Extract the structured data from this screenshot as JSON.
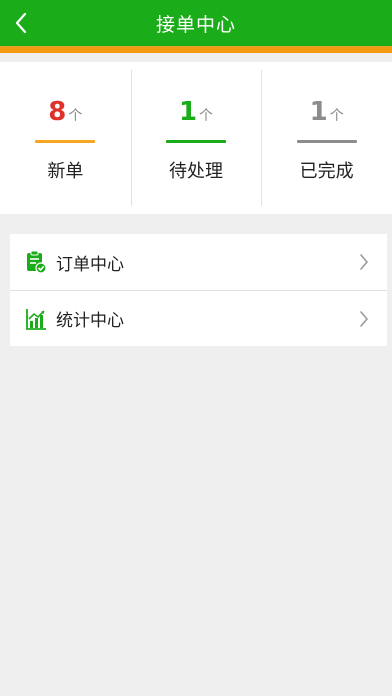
{
  "header": {
    "title": "接单中心",
    "back_icon": "back-chevron-icon",
    "bg_color": "#1aad19",
    "accent_color": "#f39c12"
  },
  "stats": [
    {
      "count": "8",
      "unit": "个",
      "label": "新单",
      "count_color": "#e0322c",
      "bar_color": "#f5a623"
    },
    {
      "count": "1",
      "unit": "个",
      "label": "待处理",
      "count_color": "#1aad19",
      "bar_color": "#1aad19"
    },
    {
      "count": "1",
      "unit": "个",
      "label": "已完成",
      "count_color": "#8c8c8c",
      "bar_color": "#8c8c8c"
    }
  ],
  "menu": [
    {
      "label": "订单中心",
      "icon": "clipboard-check-icon"
    },
    {
      "label": "统计中心",
      "icon": "bar-chart-icon"
    }
  ]
}
